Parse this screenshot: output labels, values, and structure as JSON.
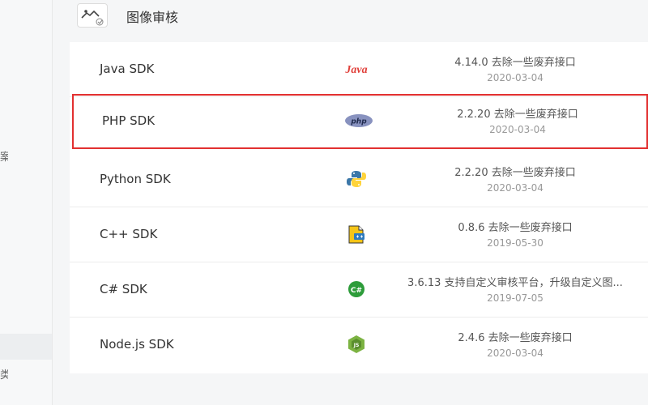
{
  "header": {
    "title": "图像审核"
  },
  "sidebar": {
    "fragments": [
      "案",
      "类"
    ]
  },
  "sdks": [
    {
      "name": "Java SDK",
      "logo": "java-logo-icon",
      "version": "4.14.0 去除一些废弃接口",
      "date": "2020-03-04",
      "selected": false
    },
    {
      "name": "PHP SDK",
      "logo": "php-logo-icon",
      "version": "2.2.20 去除一些废弃接口",
      "date": "2020-03-04",
      "selected": true
    },
    {
      "name": "Python SDK",
      "logo": "python-logo-icon",
      "version": "2.2.20 去除一些废弃接口",
      "date": "2020-03-04",
      "selected": false
    },
    {
      "name": "C++ SDK",
      "logo": "cpp-logo-icon",
      "version": "0.8.6 去除一些废弃接口",
      "date": "2019-05-30",
      "selected": false
    },
    {
      "name": "C# SDK",
      "logo": "csharp-logo-icon",
      "version": "3.6.13 支持自定义审核平台，升级自定义图...",
      "date": "2019-07-05",
      "selected": false
    },
    {
      "name": "Node.js SDK",
      "logo": "nodejs-logo-icon",
      "version": "2.4.6 去除一些废弃接口",
      "date": "2020-03-04",
      "selected": false
    }
  ],
  "logo_texts": {
    "java": "Java",
    "php": "php",
    "csharp": "C#"
  },
  "colors": {
    "selection_border": "#e23030",
    "java_red": "#e0403a",
    "php_purple": "#8892bf",
    "python_blue": "#3b77a8",
    "python_yellow": "#ffd43b",
    "csharp_green": "#2d9c3a",
    "node_green": "#7cb342"
  }
}
